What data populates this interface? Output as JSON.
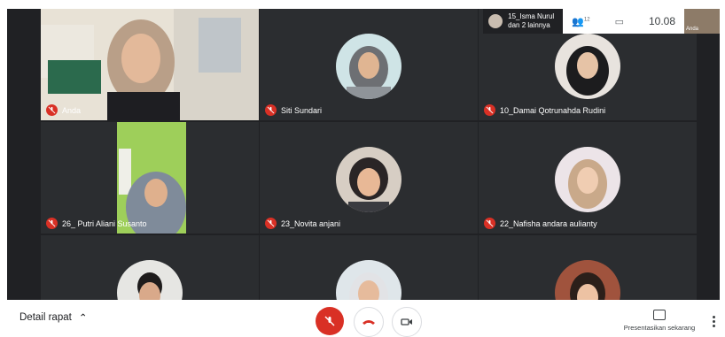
{
  "meeting": {
    "top_people": "15_Isma Nurul",
    "top_more": "dan 2 lainnya",
    "participant_count": "12",
    "time": "10.08",
    "self_thumb_label": "Anda"
  },
  "participants": [
    {
      "name": "Anda"
    },
    {
      "name": "Siti Sundari"
    },
    {
      "name": "10_Damai Qotrunahda Rudini"
    },
    {
      "name": "26_ Putri Aliani Susanto"
    },
    {
      "name": "23_Novita anjani"
    },
    {
      "name": "22_Nafisha andara aulianty"
    }
  ],
  "bottom": {
    "details_label": "Detail rapat",
    "present_label": "Presentasikan sekarang"
  },
  "icons": {
    "mic_off": "mic-off-icon",
    "end_call": "phone-hangup-icon",
    "camera": "camera-icon",
    "people": "people-icon",
    "chat": "chat-icon",
    "present": "present-screen-icon",
    "more": "more-vert-icon"
  },
  "colors": {
    "background": "#202124",
    "mic_off": "#d93025"
  }
}
